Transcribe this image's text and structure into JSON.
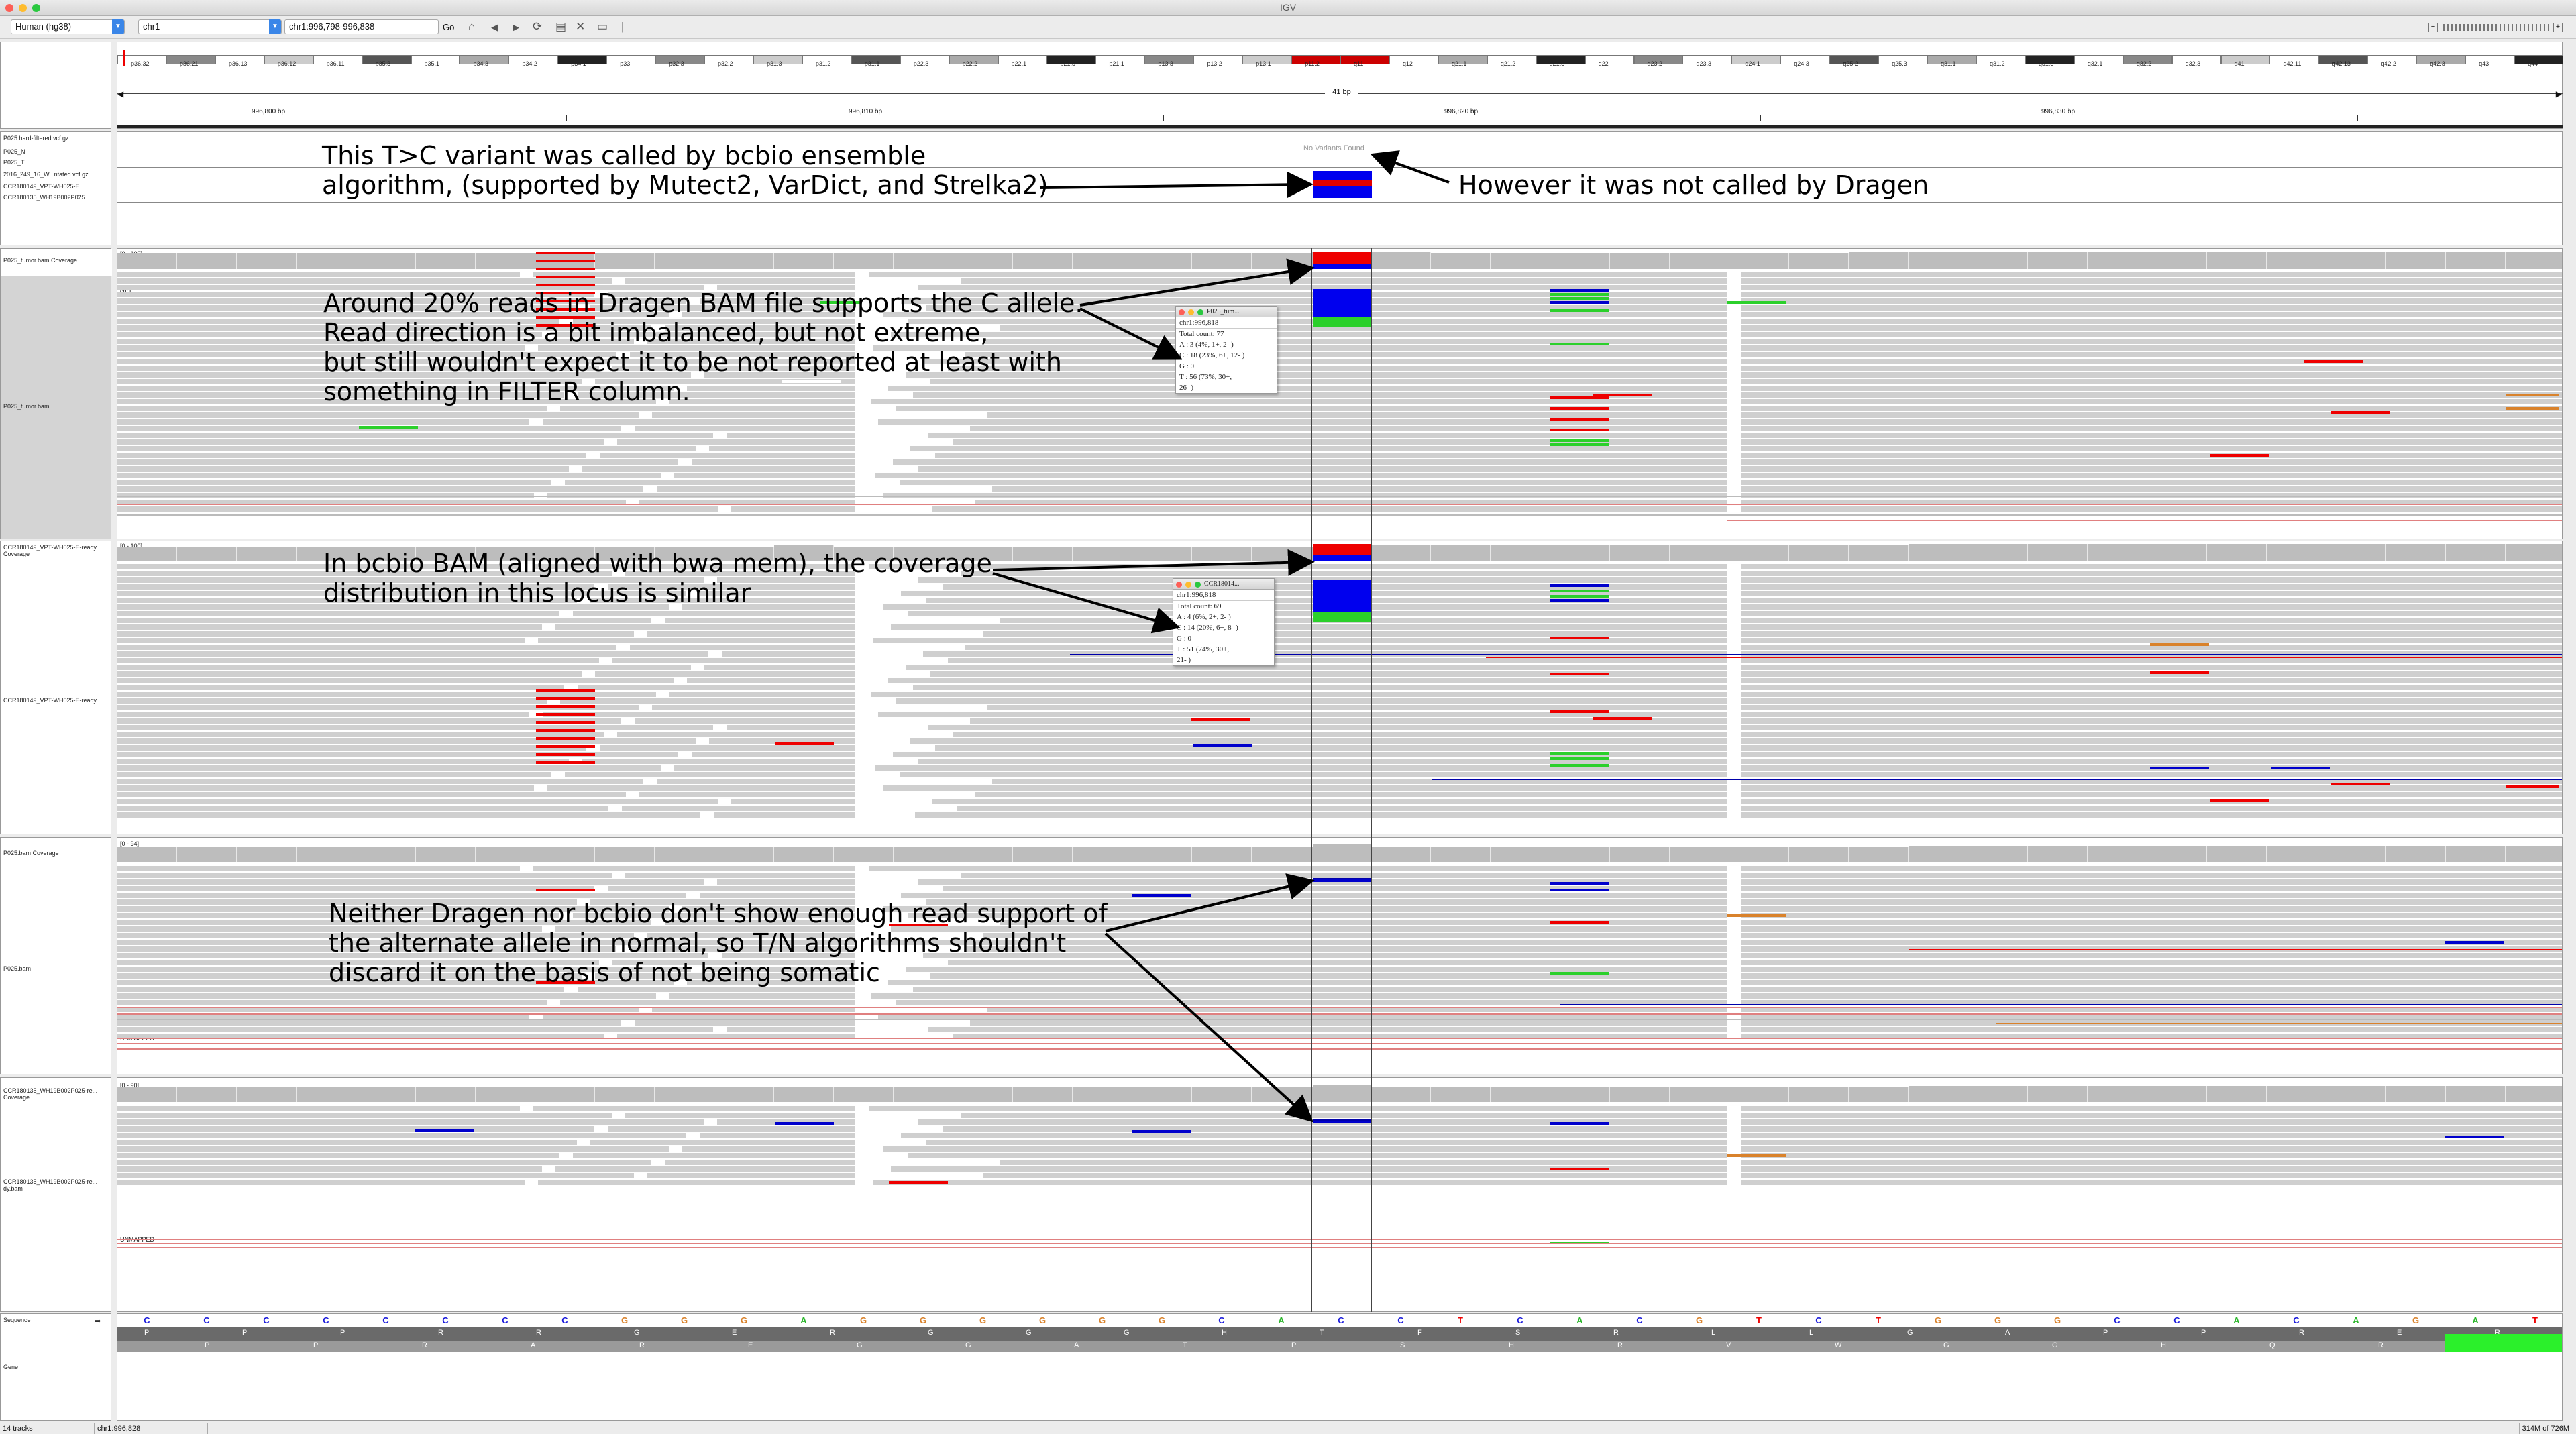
{
  "window": {
    "title": "IGV",
    "colors": {
      "close": "#fd5f57",
      "minimize": "#febc2e",
      "maximize": "#2ac840"
    }
  },
  "toolbar": {
    "genome": "Human (hg38)",
    "chromosome": "chr1",
    "locus": "chr1:996,798-996,838",
    "go_label": "Go",
    "icons": [
      "home-icon",
      "back-icon",
      "forward-icon",
      "refresh-icon",
      "roi-icon",
      "close-icon",
      "popup-text-icon",
      "ruler-icon"
    ]
  },
  "ruler": {
    "span_label": "41 bp",
    "ticks": [
      "996,800 bp",
      "996,810 bp",
      "996,820 bp",
      "996,830 bp"
    ]
  },
  "ideogram_bands": [
    "p36.32",
    "p36.21",
    "p36.13",
    "p36.12",
    "p36.11",
    "p35.3",
    "p35.1",
    "p34.3",
    "p34.2",
    "p34.1",
    "p33",
    "p32.3",
    "p32.2",
    "p31.3",
    "p31.2",
    "p31.1",
    "p22.3",
    "p22.2",
    "p22.1",
    "p21.3",
    "p21.1",
    "p13.3",
    "p13.2",
    "p13.1",
    "p11.2",
    "q11",
    "q12",
    "q21.1",
    "q21.2",
    "q21.3",
    "q22",
    "q23.2",
    "q23.3",
    "q24.1",
    "q24.3",
    "q25.2",
    "q25.3",
    "q31.1",
    "q31.2",
    "q31.3",
    "q32.1",
    "q32.2",
    "q32.3",
    "q41",
    "q42.11",
    "q42.13",
    "q42.2",
    "q42.3",
    "q43",
    "q44"
  ],
  "tracks": {
    "vcf_labels": [
      "P025.hard-filtered.vcf.gz",
      "P025_N",
      "P025_T",
      "2016_249_16_W...ntated.vcf.gz",
      "CCR180149_VPT-WH025-E",
      "CCR180135_WH19B002P025"
    ],
    "no_variants": "No Variants Found",
    "tumor_cov": "P025_tumor.bam Coverage",
    "tumor_bam": "P025_tumor.bam",
    "tumor_range": "[0 - 100]",
    "bcbio_cov": "CCR180149_VPT-WH025-E-ready Coverage",
    "bcbio_bam": "CCR180149_VPT-WH025-E-ready",
    "bcbio_range": "[0 - 100]",
    "normal_cov": "P025.bam Coverage",
    "normal_bam": "P025.bam",
    "normal_range": "[0 - 94]",
    "bcbio_normal_cov": "CCR180135_WH19B002P025-re... Coverage",
    "bcbio_normal_bam": "CCR180135_WH19B002P025-re... dy.bam",
    "bcbio_normal_range": "[0 - 90]",
    "chr_label": "chr1",
    "unmapped": "UNMAPPED",
    "sequence": "Sequence",
    "gene": "Gene"
  },
  "annotations": {
    "a1_line1": "This T>C variant was called by bcbio ensemble",
    "a1_line2": "algorithm, (supported by Mutect2, VarDict, and Strelka2)",
    "a2": "However it was not called by Dragen",
    "a3_line1": "Around 20% reads in Dragen BAM file supports the C allele.",
    "a3_line2": "Read direction is a bit imbalanced, but not extreme,",
    "a3_line3": "but still wouldn't expect it to be not reported at least with",
    "a3_line4": "something in FILTER column.",
    "a4_line1": "In bcbio BAM (aligned with bwa mem), the coverage",
    "a4_line2": "distribution in this locus is similar",
    "a5_line1": "Neither Dragen nor bcbio don't show enough read support of",
    "a5_line2": "the alternate allele in normal, so T/N algorithms shouldn't",
    "a5_line3": "discard it on the basis of not being somatic"
  },
  "popup1": {
    "title": "P025_tum...",
    "locus": "chr1:996,818",
    "total": "Total count: 77",
    "a": "A : 3 (4%, 1+, 2- )",
    "c": "C : 18 (23%, 6+, 12- )",
    "g": "G : 0",
    "t": "T : 56 (73%, 30+,",
    "t2": "26- )"
  },
  "popup2": {
    "title": "CCR18014...",
    "locus": "chr1:996,818",
    "total": "Total count: 69",
    "a": "A : 4 (6%, 2+, 2- )",
    "c": "C : 14 (20%, 6+, 8- )",
    "g": "G : 0",
    "t": "T : 51 (74%, 30+,",
    "t2": "21- )"
  },
  "sequence": [
    "C",
    "C",
    "C",
    "C",
    "C",
    "C",
    "C",
    "C",
    "G",
    "G",
    "G",
    "A",
    "G",
    "G",
    "G",
    "G",
    "G",
    "G",
    "C",
    "A",
    "C",
    "C",
    "T",
    "C",
    "A",
    "C",
    "G",
    "T",
    "C",
    "T",
    "G",
    "G",
    "G",
    "C",
    "C",
    "A",
    "C",
    "A",
    "G",
    "A",
    "T"
  ],
  "amino_top": [
    "P",
    "P",
    "P",
    "R",
    "R",
    "G",
    "E",
    "R",
    "G",
    "G",
    "G",
    "H",
    "T",
    "F",
    "S",
    "R",
    "L",
    "L",
    "G",
    "A",
    "P",
    "P",
    "R",
    "E",
    "R"
  ],
  "amino_bottom": [
    "P",
    "P",
    "R",
    "A",
    "R",
    "E",
    "G",
    "G",
    "A",
    "T",
    "P",
    "S",
    "H",
    "R",
    "V",
    "W",
    "G",
    "G",
    "H",
    "Q",
    "R",
    "M"
  ],
  "status": {
    "tracks": "14 tracks",
    "locus": "chr1:996,828",
    "memory": "314M of 726M"
  }
}
